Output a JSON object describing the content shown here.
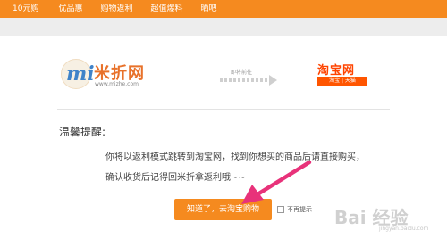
{
  "nav": {
    "items": [
      "10元购",
      "优品惠",
      "购物返利",
      "超值爆料",
      "晒吧"
    ]
  },
  "mizhe": {
    "logo_mark": "mi",
    "name": "米折网",
    "url": "www.mizhe.com"
  },
  "redirect": {
    "label": "即将前往"
  },
  "taobao": {
    "name": "淘宝网",
    "sub": "淘宝 | 天猫"
  },
  "message": {
    "title": "温馨提醒:",
    "line1": "你将以返利模式跳转到淘宝网，找到你想买的商品后请直接购买，",
    "line2": "确认收货后记得回米折拿返利哦~~"
  },
  "actions": {
    "confirm_label": "知道了，去淘宝购物",
    "no_remind_label": "不再提示"
  },
  "watermark": {
    "text": "Bai 经验",
    "sub": "jingyan.baidu.com"
  },
  "colors": {
    "accent": "#f58a1f",
    "arrow": "#e8327a",
    "taobao": "#ff4400"
  }
}
